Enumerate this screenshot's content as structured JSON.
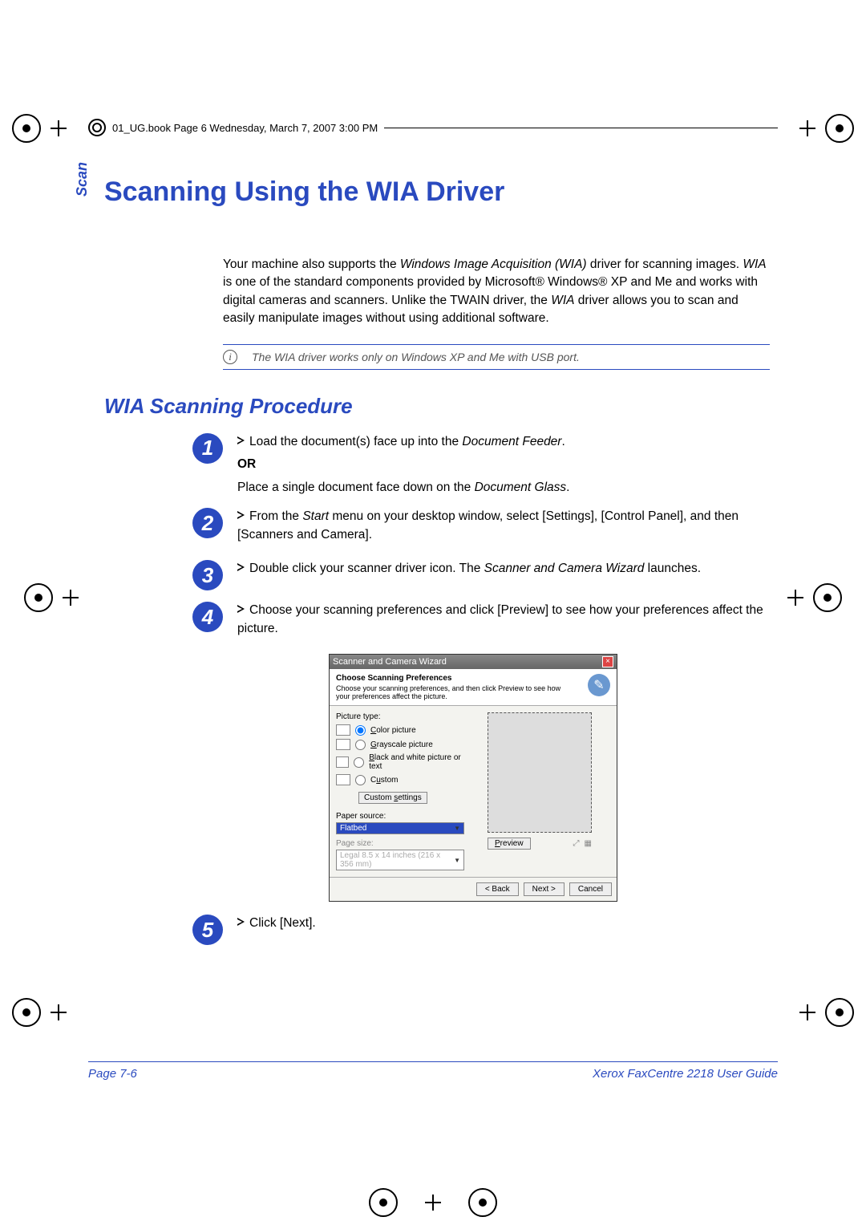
{
  "header_stamp": "01_UG.book  Page 6  Wednesday, March 7, 2007  3:00 PM",
  "side_tab": "Scan",
  "title": "Scanning Using the WIA Driver",
  "intro": {
    "p1_a": "Your machine also supports the ",
    "p1_em1": "Windows Image Acquisition (WIA)",
    "p1_b": " driver for scanning images. ",
    "p1_em2": "WIA",
    "p1_c": " is one of the standard components provided by Microsoft® Windows® XP and Me and works with digital cameras and scanners. Unlike the TWAIN driver, the ",
    "p1_em3": "WIA",
    "p1_d": " driver allows you to scan and easily manipulate images without using additional software."
  },
  "note": "The WIA driver works only on Windows XP and Me with USB port.",
  "h2": "WIA Scanning Procedure",
  "steps": {
    "s1": {
      "num": "1",
      "line1_a": "Load the document(s) face up into the ",
      "line1_em": "Document Feeder",
      "line1_b": ".",
      "or": "OR",
      "line2_a": "Place a single document face down on the ",
      "line2_em": "Document Glass",
      "line2_b": "."
    },
    "s2": {
      "num": "2",
      "text_a": "From the ",
      "text_em": "Start",
      "text_b": " menu on your desktop window, select [Settings], [Control Panel], and then [Scanners and Camera]."
    },
    "s3": {
      "num": "3",
      "text_a": "Double click your scanner driver icon. The ",
      "text_em": "Scanner and Camera Wizard",
      "text_b": " launches."
    },
    "s4": {
      "num": "4",
      "text": "Choose your scanning preferences and click [Preview] to see how your preferences affect the picture."
    },
    "s5": {
      "num": "5",
      "text": "Click [Next]."
    }
  },
  "wizard": {
    "title": "Scanner and Camera Wizard",
    "banner_title": "Choose Scanning Preferences",
    "banner_sub": "Choose your scanning preferences, and then click Preview to see how your preferences affect the picture.",
    "picture_type_label": "Picture type:",
    "opt_color": "Color picture",
    "opt_gray": "Grayscale picture",
    "opt_bw": "Black and white picture or text",
    "opt_custom": "Custom",
    "custom_settings": "Custom settings",
    "paper_source_label": "Paper source:",
    "paper_source_value": "Flatbed",
    "page_size_label": "Page size:",
    "page_size_value": "Legal 8.5 x 14 inches (216 x 356 mm)",
    "preview_btn": "Preview",
    "back_btn": "< Back",
    "next_btn": "Next >",
    "cancel_btn": "Cancel"
  },
  "footer": {
    "left": "Page 7-6",
    "right": "Xerox FaxCentre 2218 User Guide"
  }
}
